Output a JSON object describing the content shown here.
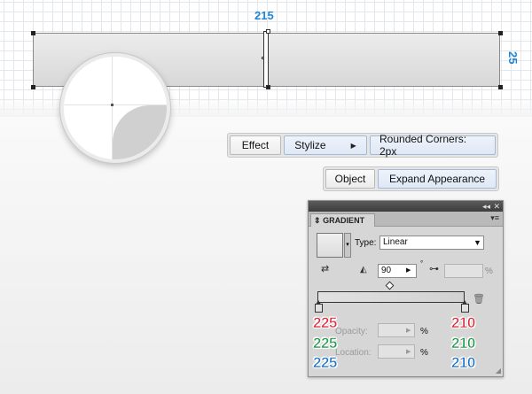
{
  "dimensions": {
    "width_label": "215",
    "height_label": "25"
  },
  "zoom": {
    "icon": "magnified-corner-preview"
  },
  "effect_menu": {
    "effect": "Effect",
    "stylize": "Stylize",
    "rounded": "Rounded Corners: 2px"
  },
  "object_menu": {
    "object": "Object",
    "expand": "Expand Appearance"
  },
  "gradient_panel": {
    "collapse_icon": "◂◂",
    "close_icon": "✕",
    "tab_label": "GRADIENT",
    "tab_icon": "⇕",
    "menu_icon": "▾≡",
    "type_label": "Type:",
    "type_value": "Linear",
    "angle_value": "90",
    "degree_symbol": "°",
    "aspect_unit": "%",
    "opacity_label": "Opacity:",
    "opacity_unit": "%",
    "location_label": "Location:",
    "location_unit": "%"
  },
  "colors": {
    "left": {
      "r": "225",
      "g": "225",
      "b": "225"
    },
    "right": {
      "r": "210",
      "g": "210",
      "b": "210"
    },
    "red": "#e02a3a",
    "green": "#1f9a4a",
    "blue": "#1a73c9"
  }
}
